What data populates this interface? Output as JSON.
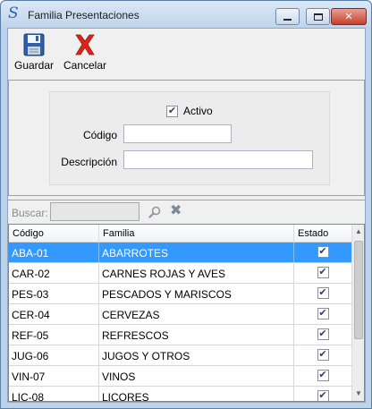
{
  "window": {
    "title": "Familia Presentaciones",
    "app_icon": "S"
  },
  "toolbar": {
    "save_label": "Guardar",
    "cancel_label": "Cancelar"
  },
  "form": {
    "active_label": "Activo",
    "active_checked": true,
    "code_label": "Código",
    "code_value": "",
    "description_label": "Descripción",
    "description_value": ""
  },
  "search": {
    "label": "Buscar:",
    "value": ""
  },
  "grid": {
    "columns": [
      "Código",
      "Familia",
      "Estado"
    ],
    "rows": [
      {
        "code": "ABA-01",
        "family": "ABARROTES",
        "active": true,
        "selected": true
      },
      {
        "code": "CAR-02",
        "family": "CARNES ROJAS Y AVES",
        "active": true,
        "selected": false
      },
      {
        "code": "PES-03",
        "family": "PESCADOS Y MARISCOS",
        "active": true,
        "selected": false
      },
      {
        "code": "CER-04",
        "family": "CERVEZAS",
        "active": true,
        "selected": false
      },
      {
        "code": "REF-05",
        "family": "REFRESCOS",
        "active": true,
        "selected": false
      },
      {
        "code": "JUG-06",
        "family": "JUGOS Y OTROS",
        "active": true,
        "selected": false
      },
      {
        "code": "VIN-07",
        "family": "VINOS",
        "active": true,
        "selected": false
      },
      {
        "code": "LIC-08",
        "family": "LICORES",
        "active": true,
        "selected": false
      }
    ]
  },
  "icons": {
    "save": "floppy-disk-icon",
    "cancel": "red-x-icon",
    "search": "magnifier-icon",
    "clear": "clear-x-icon"
  },
  "colors": {
    "selection": "#3399ff",
    "cancel_red": "#d9261c",
    "save_blue": "#2f5fa8"
  }
}
